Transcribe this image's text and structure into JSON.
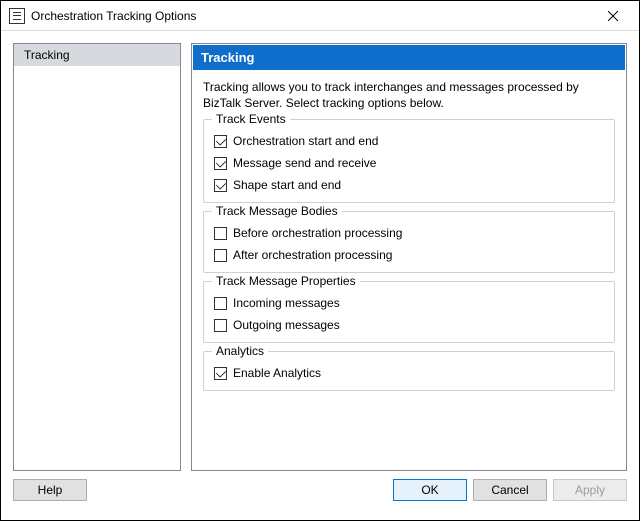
{
  "window": {
    "title": "Orchestration Tracking Options",
    "close_label": "Close"
  },
  "nav": {
    "items": [
      "Tracking"
    ],
    "selected": 0
  },
  "panel": {
    "header": "Tracking",
    "description": "Tracking allows you to track interchanges and messages processed by BizTalk Server. Select tracking options below."
  },
  "groups": [
    {
      "title": "Track Events",
      "options": [
        {
          "label": "Orchestration start and end",
          "checked": true
        },
        {
          "label": "Message send and receive",
          "checked": true
        },
        {
          "label": "Shape start and end",
          "checked": true
        }
      ]
    },
    {
      "title": "Track Message Bodies",
      "options": [
        {
          "label": "Before orchestration processing",
          "checked": false
        },
        {
          "label": "After orchestration processing",
          "checked": false
        }
      ]
    },
    {
      "title": "Track Message Properties",
      "options": [
        {
          "label": "Incoming messages",
          "checked": false
        },
        {
          "label": "Outgoing messages",
          "checked": false
        }
      ]
    },
    {
      "title": "Analytics",
      "options": [
        {
          "label": "Enable Analytics",
          "checked": true
        }
      ]
    }
  ],
  "buttons": {
    "help": "Help",
    "ok": "OK",
    "cancel": "Cancel",
    "apply": "Apply"
  }
}
